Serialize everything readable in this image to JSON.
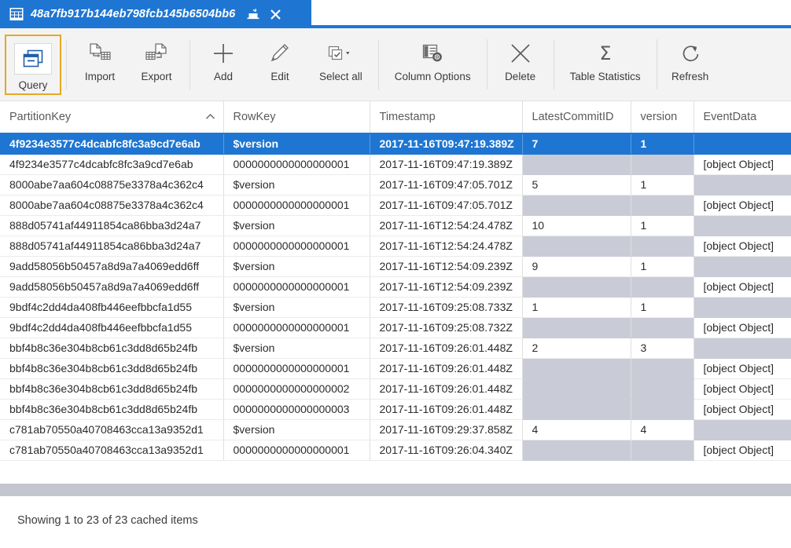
{
  "tab": {
    "title": "48a7fb917b144eb798fcb145b6504bb6",
    "grid_icon": "table-grid-icon",
    "detach_icon": "detach-window-icon",
    "close_icon": "close-icon"
  },
  "toolbar": {
    "items": [
      {
        "label": "Query",
        "icon": "query-window-icon"
      },
      {
        "label": "Import",
        "icon": "import-file-icon"
      },
      {
        "label": "Export",
        "icon": "export-file-icon"
      },
      {
        "label": "Add",
        "icon": "plus-icon"
      },
      {
        "label": "Edit",
        "icon": "pencil-icon"
      },
      {
        "label": "Select all",
        "icon": "select-all-checkbox-icon"
      },
      {
        "label": "Column Options",
        "icon": "column-options-gear-icon"
      },
      {
        "label": "Delete",
        "icon": "x-cross-icon"
      },
      {
        "label": "Table Statistics",
        "icon": "sigma-icon"
      },
      {
        "label": "Refresh",
        "icon": "refresh-circular-arrow-icon"
      }
    ]
  },
  "table": {
    "columns": [
      {
        "key": "PartitionKey",
        "label": "PartitionKey",
        "sorted": "asc"
      },
      {
        "key": "RowKey",
        "label": "RowKey",
        "sorted": ""
      },
      {
        "key": "Timestamp",
        "label": "Timestamp",
        "sorted": ""
      },
      {
        "key": "LatestCommitID",
        "label": "LatestCommitID",
        "sorted": ""
      },
      {
        "key": "version",
        "label": "version",
        "sorted": ""
      },
      {
        "key": "EventData",
        "label": "EventData",
        "sorted": ""
      }
    ],
    "rows": [
      {
        "selected": true,
        "PartitionKey": "4f9234e3577c4dcabfc8fc3a9cd7e6ab",
        "RowKey": "$version",
        "Timestamp": "2017-11-16T09:47:19.389Z",
        "LatestCommitID": "7",
        "version": "1",
        "EventData": ""
      },
      {
        "selected": false,
        "PartitionKey": "4f9234e3577c4dcabfc8fc3a9cd7e6ab",
        "RowKey": "0000000000000000001",
        "Timestamp": "2017-11-16T09:47:19.389Z",
        "LatestCommitID": "",
        "version": "",
        "EventData": "[object Object]"
      },
      {
        "selected": false,
        "PartitionKey": "8000abe7aa604c08875e3378a4c362c4",
        "RowKey": "$version",
        "Timestamp": "2017-11-16T09:47:05.701Z",
        "LatestCommitID": "5",
        "version": "1",
        "EventData": ""
      },
      {
        "selected": false,
        "PartitionKey": "8000abe7aa604c08875e3378a4c362c4",
        "RowKey": "0000000000000000001",
        "Timestamp": "2017-11-16T09:47:05.701Z",
        "LatestCommitID": "",
        "version": "",
        "EventData": "[object Object]"
      },
      {
        "selected": false,
        "PartitionKey": "888d05741af44911854ca86bba3d24a7",
        "RowKey": "$version",
        "Timestamp": "2017-11-16T12:54:24.478Z",
        "LatestCommitID": "10",
        "version": "1",
        "EventData": ""
      },
      {
        "selected": false,
        "PartitionKey": "888d05741af44911854ca86bba3d24a7",
        "RowKey": "0000000000000000001",
        "Timestamp": "2017-11-16T12:54:24.478Z",
        "LatestCommitID": "",
        "version": "",
        "EventData": "[object Object]"
      },
      {
        "selected": false,
        "PartitionKey": "9add58056b50457a8d9a7a4069edd6ff",
        "RowKey": "$version",
        "Timestamp": "2017-11-16T12:54:09.239Z",
        "LatestCommitID": "9",
        "version": "1",
        "EventData": ""
      },
      {
        "selected": false,
        "PartitionKey": "9add58056b50457a8d9a7a4069edd6ff",
        "RowKey": "0000000000000000001",
        "Timestamp": "2017-11-16T12:54:09.239Z",
        "LatestCommitID": "",
        "version": "",
        "EventData": "[object Object]"
      },
      {
        "selected": false,
        "PartitionKey": "9bdf4c2dd4da408fb446eefbbcfa1d55",
        "RowKey": "$version",
        "Timestamp": "2017-11-16T09:25:08.733Z",
        "LatestCommitID": "1",
        "version": "1",
        "EventData": ""
      },
      {
        "selected": false,
        "PartitionKey": "9bdf4c2dd4da408fb446eefbbcfa1d55",
        "RowKey": "0000000000000000001",
        "Timestamp": "2017-11-16T09:25:08.732Z",
        "LatestCommitID": "",
        "version": "",
        "EventData": "[object Object]"
      },
      {
        "selected": false,
        "PartitionKey": "bbf4b8c36e304b8cb61c3dd8d65b24fb",
        "RowKey": "$version",
        "Timestamp": "2017-11-16T09:26:01.448Z",
        "LatestCommitID": "2",
        "version": "3",
        "EventData": ""
      },
      {
        "selected": false,
        "PartitionKey": "bbf4b8c36e304b8cb61c3dd8d65b24fb",
        "RowKey": "0000000000000000001",
        "Timestamp": "2017-11-16T09:26:01.448Z",
        "LatestCommitID": "",
        "version": "",
        "EventData": "[object Object]"
      },
      {
        "selected": false,
        "PartitionKey": "bbf4b8c36e304b8cb61c3dd8d65b24fb",
        "RowKey": "0000000000000000002",
        "Timestamp": "2017-11-16T09:26:01.448Z",
        "LatestCommitID": "",
        "version": "",
        "EventData": "[object Object]"
      },
      {
        "selected": false,
        "PartitionKey": "bbf4b8c36e304b8cb61c3dd8d65b24fb",
        "RowKey": "0000000000000000003",
        "Timestamp": "2017-11-16T09:26:01.448Z",
        "LatestCommitID": "",
        "version": "",
        "EventData": "[object Object]"
      },
      {
        "selected": false,
        "PartitionKey": "c781ab70550a40708463cca13a9352d1",
        "RowKey": "$version",
        "Timestamp": "2017-11-16T09:29:37.858Z",
        "LatestCommitID": "4",
        "version": "4",
        "EventData": ""
      },
      {
        "selected": false,
        "PartitionKey": "c781ab70550a40708463cca13a9352d1",
        "RowKey": "0000000000000000001",
        "Timestamp": "2017-11-16T09:26:04.340Z",
        "LatestCommitID": "",
        "version": "",
        "EventData": "[object Object]"
      }
    ]
  },
  "statusbar": {
    "text": "Showing 1 to 23 of 23 cached items"
  },
  "colors": {
    "accent": "#1e76d2",
    "selection": "#1e76d2",
    "empty_cell": "#c9ccd6",
    "ribbon_bg": "#f3f3f3",
    "focus_outline": "#e5a823",
    "scrollbar": "#c3c6ce"
  }
}
